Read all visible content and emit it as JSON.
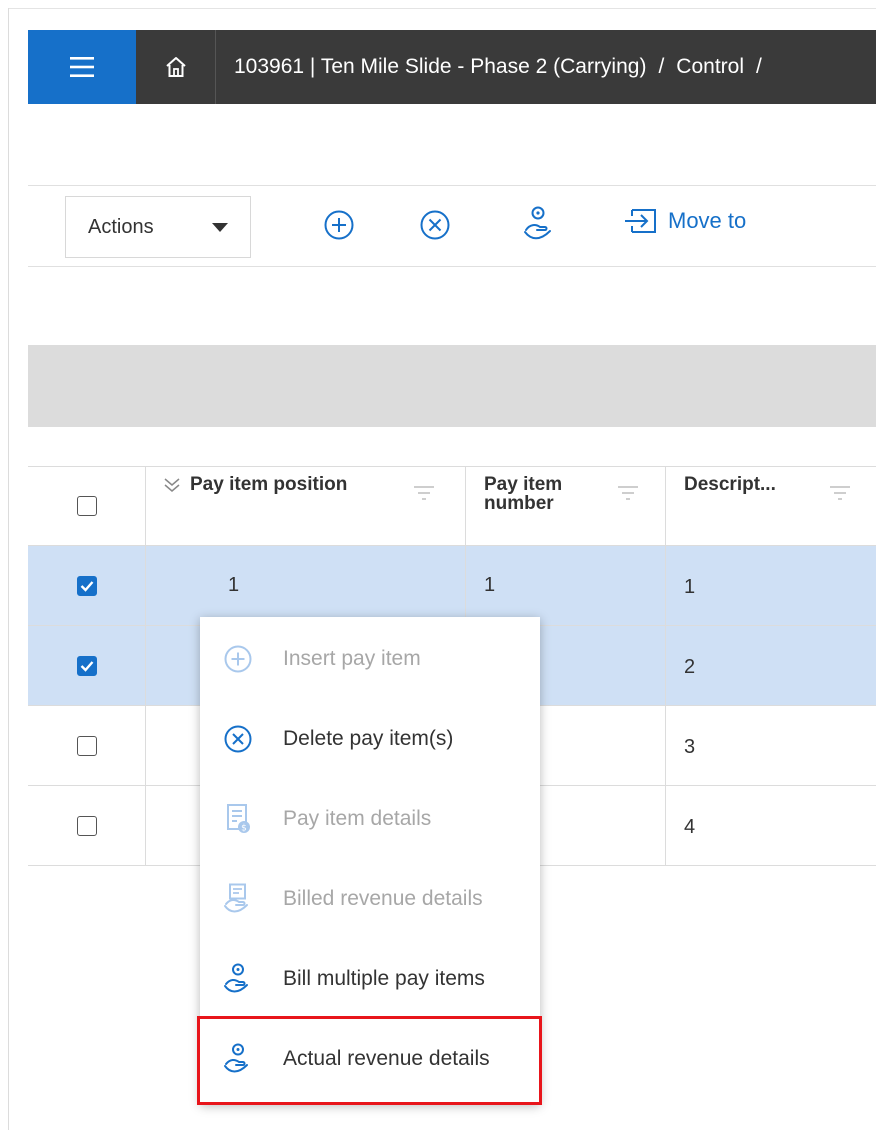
{
  "topbar": {
    "breadcrumb_project": "103961 | Ten Mile Slide - Phase 2 (Carrying)",
    "breadcrumb_sep1": "/",
    "breadcrumb_control": "Control",
    "breadcrumb_sep2": "/"
  },
  "toolbar": {
    "actions_label": "Actions",
    "move_to_label": "Move to"
  },
  "grid": {
    "columns": [
      "Pay item position",
      "Pay item number",
      "Descript..."
    ],
    "rows": [
      {
        "checked": true,
        "position": "1",
        "number": "1",
        "description": "1"
      },
      {
        "checked": true,
        "position": "",
        "number": "",
        "description": "2"
      },
      {
        "checked": false,
        "position": "",
        "number": "",
        "description": "3"
      },
      {
        "checked": false,
        "position": "",
        "number": "",
        "description": "4"
      }
    ]
  },
  "context_menu": {
    "items": [
      {
        "label": "Insert pay item",
        "enabled": false,
        "icon": "plus-circle-icon"
      },
      {
        "label": "Delete pay item(s)",
        "enabled": true,
        "icon": "x-circle-icon"
      },
      {
        "label": "Pay item details",
        "enabled": false,
        "icon": "document-money-icon"
      },
      {
        "label": "Billed revenue details",
        "enabled": false,
        "icon": "billed-revenue-icon"
      },
      {
        "label": "Bill multiple pay items",
        "enabled": true,
        "icon": "hand-coin-icon"
      },
      {
        "label": "Actual revenue details",
        "enabled": true,
        "icon": "hand-coin-icon"
      }
    ]
  },
  "colors": {
    "accent": "#1670c9",
    "topbar": "#3a3a3a",
    "selected_row": "#cfe0f5",
    "highlight": "#e8151b"
  }
}
